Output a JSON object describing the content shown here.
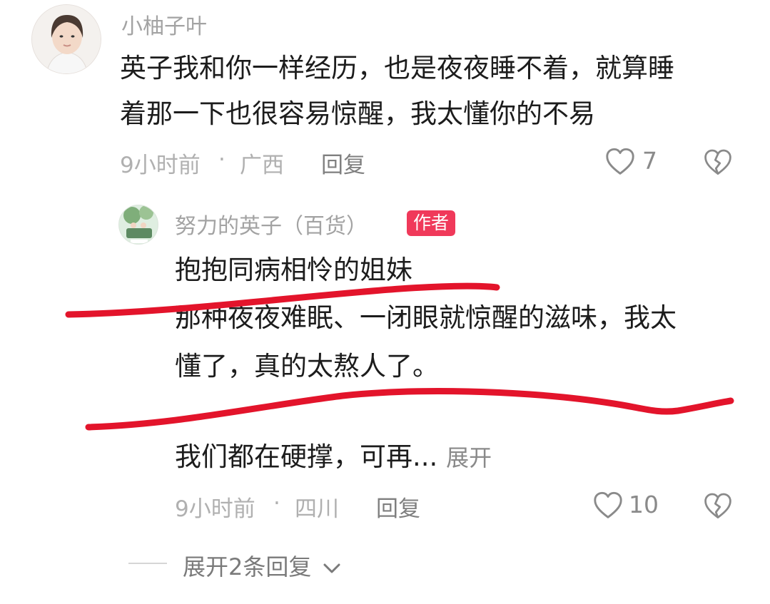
{
  "comment": {
    "username": "小柚子叶",
    "text_line1": "英子我和你一样经历，也是夜夜睡不着，就算睡",
    "text_line2": "着那一下也很容易惊醒，我太懂你的不易",
    "time": "9小时前",
    "separator": "·",
    "location": "广西",
    "reply_label": "回复",
    "like_count": "7",
    "like_icon": "heart-outline-icon",
    "dislike_icon": "broken-heart-icon"
  },
  "reply": {
    "username": "努力的英子（百货）",
    "author_tag": "作者",
    "line1": "抱抱同病相怜的姐妹",
    "line2": "那种夜夜难眠、一闭眼就惊醒的滋味，我太",
    "line3": "懂了，真的太熬人了。",
    "line4": "我们都在硬撑，可再...",
    "expand_label": "展开",
    "time": "9小时前",
    "separator": "·",
    "location": "四川",
    "reply_label": "回复",
    "like_count": "10",
    "like_icon": "heart-outline-icon",
    "dislike_icon": "broken-heart-icon"
  },
  "more_replies": {
    "label": "展开2条回复",
    "icon": "chevron-down-icon"
  },
  "colors": {
    "author_tag": "#f0395a",
    "annotation_stroke": "#e3142b"
  }
}
